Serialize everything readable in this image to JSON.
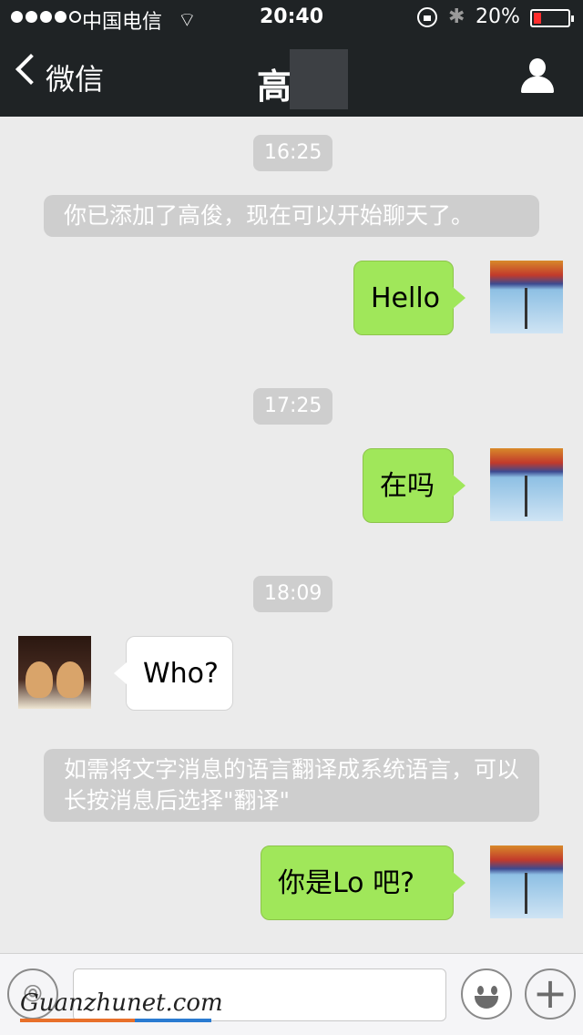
{
  "status_bar": {
    "carrier": "中国电信",
    "time": "20:40",
    "battery": "20%",
    "battery_level": 0.2,
    "battery_color": "#ff2d2d"
  },
  "nav": {
    "back_label": "微信",
    "title": "高"
  },
  "messages": {
    "t1": "16:25",
    "sys1": "你已添加了高俊，现在可以开始聊天了。",
    "m1": "Hello",
    "t2": "17:25",
    "m2": "在吗",
    "t3": "18:09",
    "m3": "Who?",
    "sys2": "如需将文字消息的语言翻译成系统语言，可以长按消息后选择\"翻译\"",
    "m4": "你是Lo 吧?"
  },
  "input_bar": {
    "watermark": "Guanzhunet.com"
  },
  "colors": {
    "outgoing_bubble": "#a0e75a",
    "header_bg": "#1f2325",
    "chat_bg": "#ebebeb"
  }
}
